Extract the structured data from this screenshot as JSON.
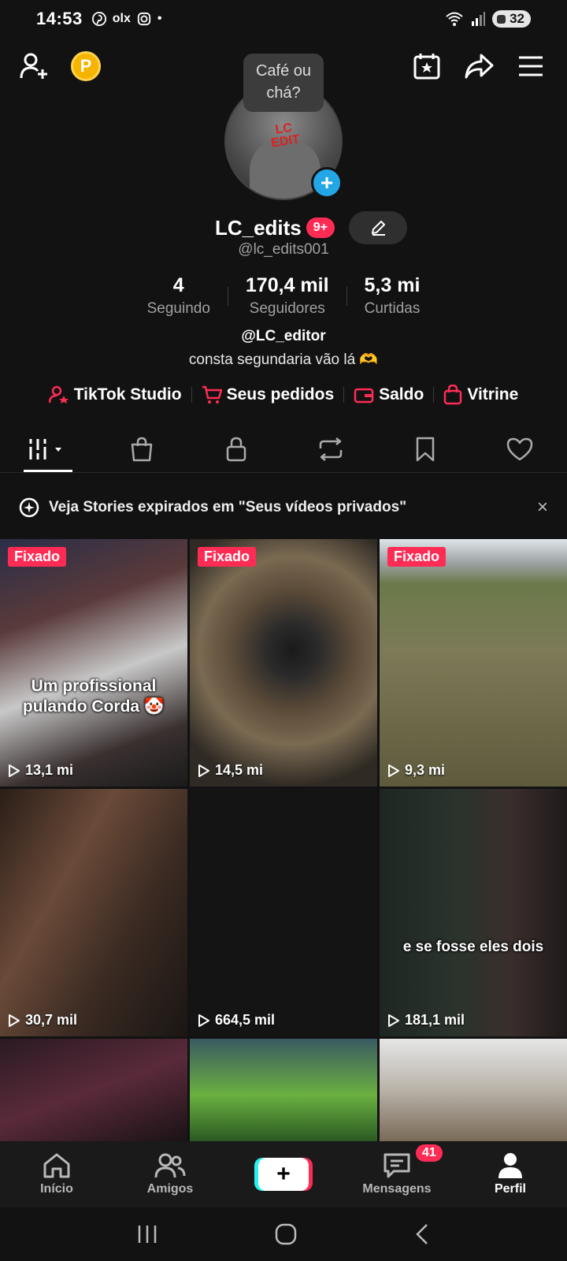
{
  "status_bar": {
    "time": "14:53",
    "apps": [
      "pinterest",
      "olx",
      "instagram"
    ],
    "olx_label": "olx",
    "dot": "•",
    "battery": "32"
  },
  "profile": {
    "note_bubble": "Café ou chá?",
    "username": "LC_edits",
    "notifications": "9+",
    "handle": "@lc_edits001",
    "stats": [
      {
        "value": "4",
        "label": "Seguindo"
      },
      {
        "value": "170,4 mil",
        "label": "Seguidores"
      },
      {
        "value": "5,3 mi",
        "label": "Curtidas"
      }
    ],
    "bio_handle": "@LC_editor",
    "bio_text": "consta segundaria vão lá 🫶"
  },
  "links": [
    {
      "label": "TikTok Studio",
      "icon": "user-star-icon"
    },
    {
      "label": "Seus pedidos",
      "icon": "cart-icon"
    },
    {
      "label": "Saldo",
      "icon": "wallet-icon"
    },
    {
      "label": "Vitrine",
      "icon": "shopping-bag-icon"
    }
  ],
  "tabs": [
    "videos-grid",
    "shop",
    "private",
    "reposts",
    "favorites",
    "liked"
  ],
  "banner": {
    "text": "Veja Stories expirados em \"Seus vídeos privados\"",
    "close": "×"
  },
  "videos": [
    {
      "pinned": "Fixado",
      "views": "13,1 mi",
      "overlay": "Um profissional pulando Corda 🤡"
    },
    {
      "pinned": "Fixado",
      "views": "14,5 mi",
      "overlay": ""
    },
    {
      "pinned": "Fixado",
      "views": "9,3 mi",
      "overlay": ""
    },
    {
      "pinned": "",
      "views": "30,7 mil",
      "overlay": ""
    },
    {
      "pinned": "",
      "views": "664,5 mil",
      "overlay": ""
    },
    {
      "pinned": "",
      "views": "181,1 mil",
      "overlay": "e se fosse eles dois"
    }
  ],
  "bottom_nav": [
    {
      "label": "Início"
    },
    {
      "label": "Amigos"
    },
    {
      "label": "+"
    },
    {
      "label": "Mensagens",
      "badge": "41"
    },
    {
      "label": "Perfil"
    }
  ],
  "colors": {
    "accent": "#fe2c55",
    "cyan": "#25f4ee",
    "background": "#121212"
  }
}
